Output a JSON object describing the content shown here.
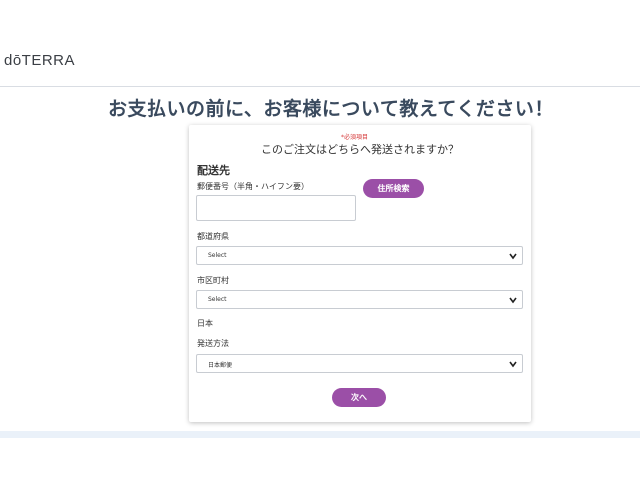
{
  "header": {
    "logo_text": "dōTERRA"
  },
  "page_heading": "お支払いの前に、お客様について教えてください！",
  "form": {
    "required_note": "*必須項目",
    "question": "このご注文はどちらへ発送されますか？",
    "section_title": "配送先",
    "postal_label": "郵便番号（半角・ハイフン要）",
    "postal_value": "",
    "address_search_label": "住所検索",
    "prefecture_label": "都道府県",
    "prefecture_value": "Select",
    "city_label": "市区町村",
    "city_value": "Select",
    "country_text": "日本",
    "shipping_method_label": "発送方法",
    "shipping_method_value": "日本郵便",
    "next_label": "次へ"
  },
  "colors": {
    "accent": "#9b4fa7",
    "required": "#d63a3a",
    "heading": "#3a4a5e"
  },
  "icons": {
    "select_arrow": "chevron-down-icon"
  }
}
